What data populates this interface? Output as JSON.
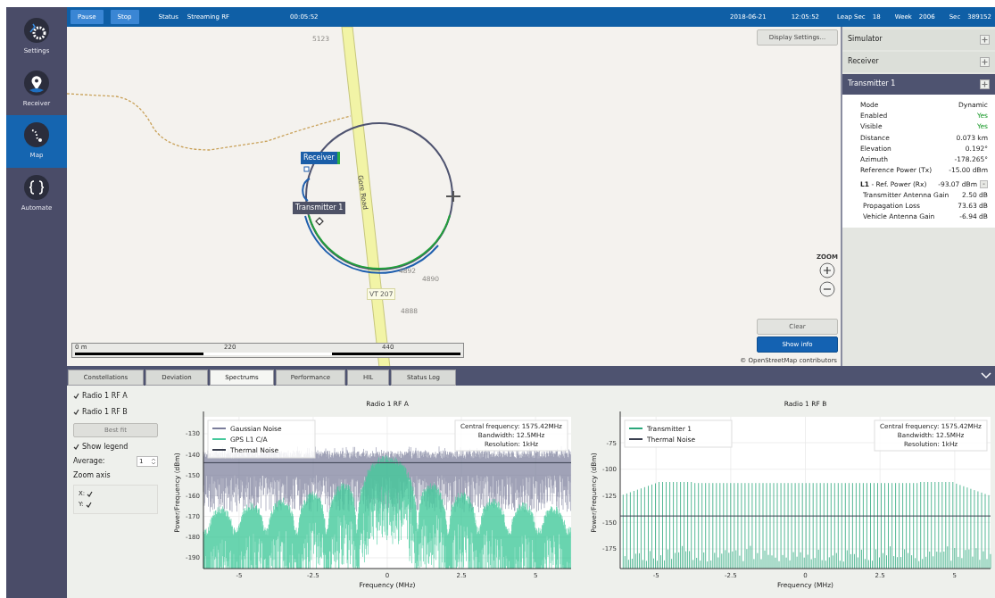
{
  "top_bar": {
    "buttons": [
      "Pause",
      "Stop"
    ],
    "status_label": "Status",
    "status": "Streaming RF",
    "elapsed": "00:05:52",
    "date": "2018-06-21",
    "time": "12:05:52",
    "fields": [
      {
        "label": "Leap Sec",
        "value": "18"
      },
      {
        "label": "Week",
        "value": "2006"
      },
      {
        "label": "Sec",
        "value": "389152"
      }
    ]
  },
  "sidebar": {
    "items": [
      {
        "label": "Settings",
        "kind": "settings",
        "selected": false
      },
      {
        "label": "Receiver",
        "kind": "receiver",
        "selected": false
      },
      {
        "label": "Map",
        "kind": "map",
        "selected": true
      },
      {
        "label": "Automate",
        "kind": "automate",
        "selected": false
      }
    ]
  },
  "map": {
    "place_labels": [
      "5123",
      "4892",
      "4890",
      "4888"
    ],
    "road_name": "Gore Road",
    "road_shield": "VT 207",
    "markers": [
      {
        "label": "Receiver",
        "kind": "receiver"
      },
      {
        "label": "Transmitter 1",
        "kind": "transmitter"
      }
    ],
    "scale": [
      "0 m",
      "220",
      "440"
    ],
    "display_settings": "Display Settings...",
    "zoom_label": "ZOOM",
    "buttons": [
      {
        "label": "Clear",
        "primary": false
      },
      {
        "label": "Show info",
        "primary": true
      }
    ],
    "attribution": "© OpenStreetMap contributors"
  },
  "right_panel": {
    "sections": [
      {
        "title": "Simulator",
        "expanded": false
      },
      {
        "title": "Receiver",
        "expanded": false
      },
      {
        "title": "Transmitter 1",
        "expanded": true
      }
    ],
    "properties": [
      {
        "label": "Mode",
        "value": "Dynamic",
        "positive": false
      },
      {
        "label": "Enabled",
        "value": "Yes",
        "positive": true
      },
      {
        "label": "Visible",
        "value": "Yes",
        "positive": true
      },
      {
        "label": "Distance",
        "value": "0.073 km",
        "positive": false
      },
      {
        "label": "Elevation",
        "value": "0.192°",
        "positive": false
      },
      {
        "label": "Azimuth",
        "value": "-178.265°",
        "positive": false
      },
      {
        "label": "Reference Power (Tx)",
        "value": "-15.00 dBm",
        "positive": false
      }
    ],
    "power_group": {
      "label": "**L1** - Ref. Power (Rx)",
      "value": "-93.07 dBm",
      "toggle": "-",
      "expanded": true,
      "items": [
        {
          "label": "Transmitter Antenna Gain",
          "value": "2.50 dB"
        },
        {
          "label": "Propagation Loss",
          "value": "73.63 dB"
        },
        {
          "label": "Vehicle Antenna Gain",
          "value": "-6.94 dB"
        }
      ]
    }
  },
  "bottom_tabs": [
    {
      "label": "Constellations",
      "selected": false
    },
    {
      "label": "Deviation",
      "selected": false
    },
    {
      "label": "Spectrums",
      "selected": true
    },
    {
      "label": "Performance",
      "selected": false
    },
    {
      "label": "HIL",
      "selected": false
    },
    {
      "label": "Status Log",
      "selected": false
    }
  ],
  "spectrum_controls": {
    "checkboxes": [
      {
        "label": "Radio 1 RF A",
        "checked": true
      },
      {
        "label": "Radio 1 RF B",
        "checked": true
      }
    ],
    "best_fit": "Best fit",
    "show_legend": {
      "label": "Show legend",
      "checked": true
    },
    "average": {
      "label": "Average:",
      "value": "1"
    },
    "zoom_axis": {
      "title": "Zoom axis",
      "axes": [
        {
          "label": "X:",
          "checked": true
        },
        {
          "label": "Y:",
          "checked": true
        }
      ]
    }
  },
  "charts": [
    {
      "title": "Radio 1 RF A",
      "kind": "wideband",
      "ylabel": "Power/Frequency (dBm)",
      "xlabel": "Frequency (MHz)",
      "yticks": [
        "-130",
        "-140",
        "-150",
        "-160",
        "-170",
        "-180",
        "-190"
      ],
      "xticks": [
        "-5",
        "-2.5",
        "0",
        "2.5",
        "5"
      ],
      "legend": [
        {
          "label": "Gaussian Noise",
          "color": "#7b7d9b"
        },
        {
          "label": "GPS L1 C/A",
          "color": "#45c99c"
        },
        {
          "label": "Thermal Noise",
          "color": "#3a3f4f"
        }
      ],
      "info": [
        "Central frequency: 1575.42MHz",
        "Bandwidth: 12.5MHz",
        "Resolution: 1kHz"
      ]
    },
    {
      "title": "Radio 1 RF B",
      "kind": "comb",
      "ylabel": "Power/Frequency (dBm)",
      "xlabel": "Frequency (MHz)",
      "yticks": [
        "-75",
        "-100",
        "-125",
        "-150",
        "-175"
      ],
      "xticks": [
        "-5",
        "-2.5",
        "0",
        "2.5",
        "5"
      ],
      "legend": [
        {
          "label": "Transmitter 1",
          "color": "#2ba77b"
        },
        {
          "label": "Thermal Noise",
          "color": "#3a3f4f"
        }
      ],
      "info": [
        "Central frequency: 1575.42MHz",
        "Bandwidth: 12.5MHz",
        "Resolution: 1kHz"
      ]
    }
  ]
}
